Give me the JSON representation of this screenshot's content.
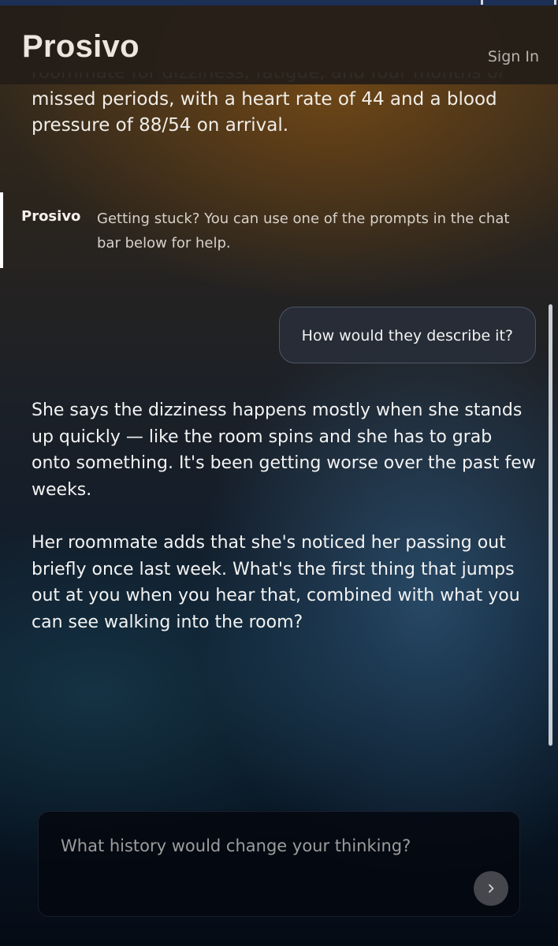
{
  "header": {
    "brand": "Prosivo",
    "sign_in_label": "Sign In"
  },
  "conversation": {
    "case_tail_partial": "roommate for dizziness, fatigue, and four months of",
    "case_tail": "missed periods, with a heart rate of 44 and a blood pressure of 88/54 on arrival.",
    "tip": {
      "label": "Prosivo",
      "text": "Getting stuck? You can use one of the prompts in the chat bar below for help."
    },
    "user_message": "How would they describe it?",
    "assistant_message": {
      "paragraph_1": "She says the dizziness happens mostly when she stands up quickly — like the room spins and she has to grab onto something. It's been getting worse over the past few weeks.",
      "paragraph_2": "Her roommate adds that she's noticed her passing out briefly once last week. What's the first thing that jumps out at you when you hear that, combined with what you can see walking into the room?"
    }
  },
  "composer": {
    "placeholder": "What history would change your thinking?",
    "value": "",
    "send_icon": "chevron-right-icon"
  }
}
